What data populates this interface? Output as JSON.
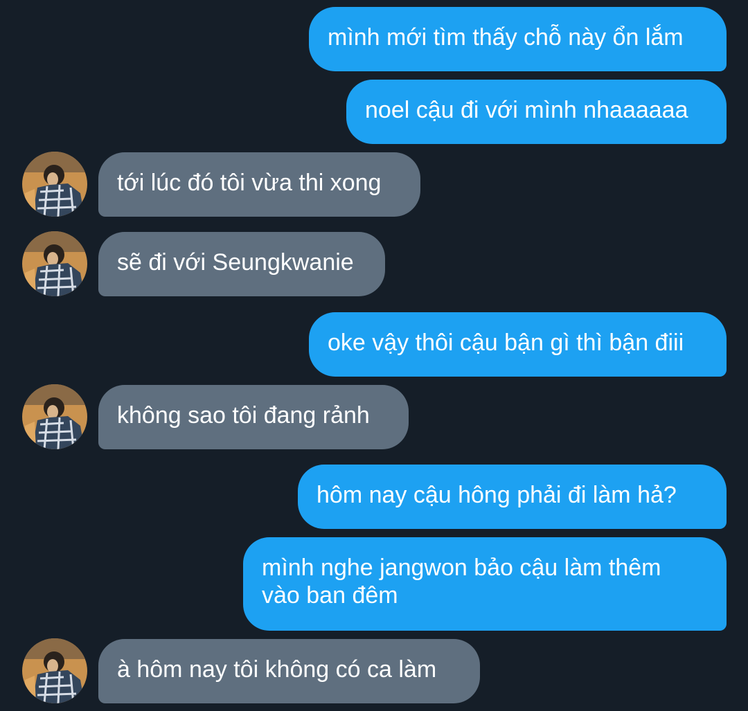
{
  "conversation": {
    "messages": [
      {
        "from": "me",
        "text": "mình mới tìm thấy chỗ này ổn lắm"
      },
      {
        "from": "me",
        "text": "noel cậu đi với mình nhaaaaaa"
      },
      {
        "from": "them",
        "text": "tới lúc đó tôi vừa thi xong",
        "avatar": "profile-photo"
      },
      {
        "from": "them",
        "text": "sẽ đi với Seungkwanie",
        "avatar": "profile-photo"
      },
      {
        "from": "me",
        "text": "oke vậy thôi cậu bận gì thì bận điii"
      },
      {
        "from": "them",
        "text": "không sao tôi đang rảnh",
        "avatar": "profile-photo"
      },
      {
        "from": "me",
        "text": "hôm nay cậu hông phải đi làm hả?"
      },
      {
        "from": "me",
        "text": "mình nghe jangwon bảo cậu làm thêm\nvào ban đêm"
      },
      {
        "from": "them",
        "text": "à hôm nay tôi không có ca làm",
        "avatar": "profile-photo"
      }
    ]
  },
  "colors": {
    "background": "#151e28",
    "sent_bubble": "#1da1f2",
    "received_bubble": "#5f6f7f",
    "text": "#ffffff"
  }
}
